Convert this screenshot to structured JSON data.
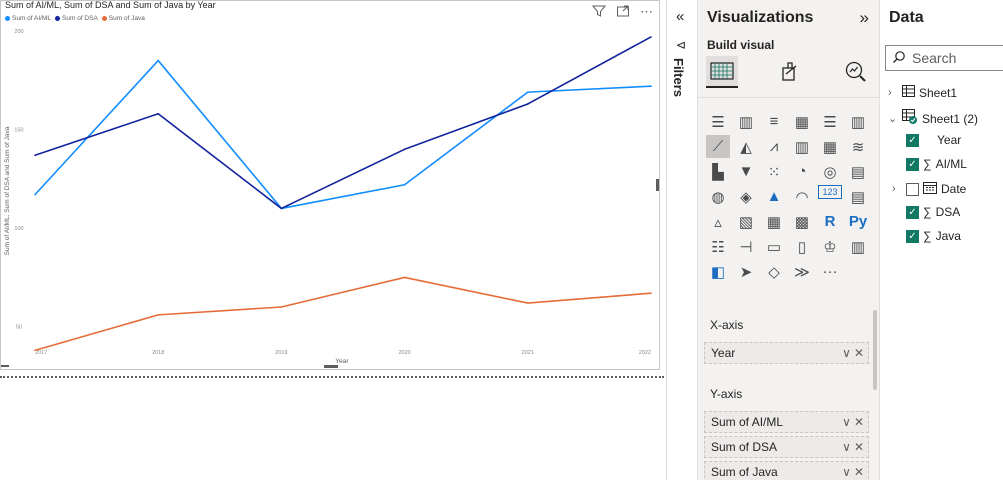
{
  "canvas": {
    "visual_header": {
      "filter_icon": "funnel-icon",
      "focus_icon": "focus-mode-icon",
      "more_icon": "more-options-icon",
      "more_label": "⋯"
    }
  },
  "chart_data": {
    "type": "line",
    "title": "Sum of AI/ML, Sum of DSA and Sum of Java by Year",
    "xlabel": "Year",
    "ylabel": "Sum of AI/ML, Sum of DSA and Sum of Java",
    "x": [
      2017,
      2018,
      2019,
      2020,
      2021,
      2022
    ],
    "x_tick_labels": [
      "2017",
      "2018",
      "2019",
      "2020",
      "2021",
      "2022"
    ],
    "y_tick_labels": [
      "50",
      "100",
      "150",
      "200"
    ],
    "ylim": [
      25,
      200
    ],
    "grid": false,
    "legend_position": "top-left",
    "series": [
      {
        "name": "Sum of AI/ML",
        "color": "#118dff",
        "values": [
          117,
          185,
          110,
          122,
          169,
          172
        ]
      },
      {
        "name": "Sum of DSA",
        "color": "#12239e",
        "values": [
          137,
          158,
          110,
          140,
          163,
          197
        ]
      },
      {
        "name": "Sum of Java",
        "color": "#e66c37",
        "values": [
          38,
          56,
          60,
          75,
          62,
          67
        ]
      }
    ]
  },
  "filters": {
    "label": "Filters",
    "collapse_glyph": "«",
    "funnel_glyph": "⊲"
  },
  "visualizations": {
    "title": "Visualizations",
    "expand_glyph": "»",
    "build_visual_label": "Build visual",
    "tabs": [
      "build-visual",
      "format-visual",
      "analytics"
    ],
    "gallery_icons": [
      "stacked-bar",
      "stacked-column",
      "clustered-bar",
      "clustered-column",
      "100-bar",
      "100-column",
      "line",
      "area",
      "stacked-area",
      "line-column",
      "line-clustered-column",
      "ribbon",
      "waterfall",
      "funnel",
      "scatter",
      "pie",
      "donut",
      "treemap",
      "map",
      "filled-map",
      "azure-map",
      "gauge",
      "card",
      "multi-row-card",
      "kpi",
      "slicer",
      "table",
      "matrix",
      "r-visual",
      "python-visual",
      "key-influencers",
      "decomposition-tree",
      "qa",
      "smart-narrative",
      "goals",
      "paginated-report",
      "power-apps",
      "power-automate",
      "shape-map",
      "arrow",
      "more"
    ],
    "r_label": "R",
    "py_label": "Py",
    "card_label": "123",
    "more_label": "···",
    "wells": {
      "x_axis_label": "X-axis",
      "x_field": "Year",
      "y_axis_label": "Y-axis",
      "y_fields": [
        "Sum of AI/ML",
        "Sum of DSA",
        "Sum of Java"
      ]
    },
    "pill_icons": {
      "dropdown": "∨",
      "remove": "✕"
    }
  },
  "data_pane": {
    "title": "Data",
    "search_placeholder": "Search",
    "tables": [
      {
        "name": "Sheet1",
        "expanded": false
      },
      {
        "name": "Sheet1 (2)",
        "expanded": true
      }
    ],
    "fields": [
      {
        "name": "Year",
        "checked": true,
        "sigma": false,
        "calendar": false,
        "chevron": false
      },
      {
        "name": "AI/ML",
        "checked": true,
        "sigma": true,
        "calendar": false,
        "chevron": false
      },
      {
        "name": "Date",
        "checked": false,
        "sigma": false,
        "calendar": true,
        "chevron": true
      },
      {
        "name": "DSA",
        "checked": true,
        "sigma": true,
        "calendar": false,
        "chevron": false
      },
      {
        "name": "Java",
        "checked": true,
        "sigma": true,
        "calendar": false,
        "chevron": false
      }
    ],
    "sigma_glyph": "∑",
    "check_glyph": "✓"
  }
}
